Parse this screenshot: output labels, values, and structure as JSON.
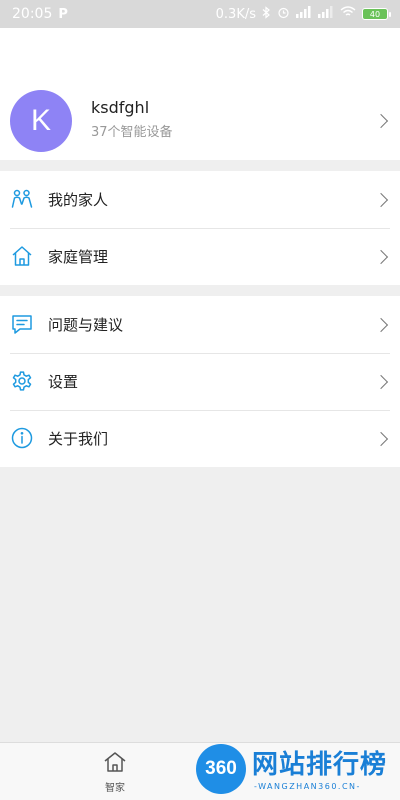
{
  "status_bar": {
    "time": "20:05",
    "app_icon": "P",
    "net_speed": "0.3K/s",
    "battery": "40"
  },
  "profile": {
    "avatar_letter": "K",
    "name": "ksdfghl",
    "device_count": "37个智能设备"
  },
  "menu_group_1": [
    {
      "icon": "family-icon",
      "label": "我的家人"
    },
    {
      "icon": "home-icon",
      "label": "家庭管理"
    }
  ],
  "menu_group_2": [
    {
      "icon": "feedback-icon",
      "label": "问题与建议"
    },
    {
      "icon": "settings-icon",
      "label": "设置"
    },
    {
      "icon": "info-icon",
      "label": "关于我们"
    }
  ],
  "tab_bar": {
    "tab_home_label": "智家"
  },
  "watermark": {
    "logo_text": "360",
    "title": "网站排行榜",
    "subtitle": "-WANGZHAN360.CN-"
  },
  "colors": {
    "accent_blue": "#1e9ae0",
    "avatar_bg": "#8e83f5"
  }
}
